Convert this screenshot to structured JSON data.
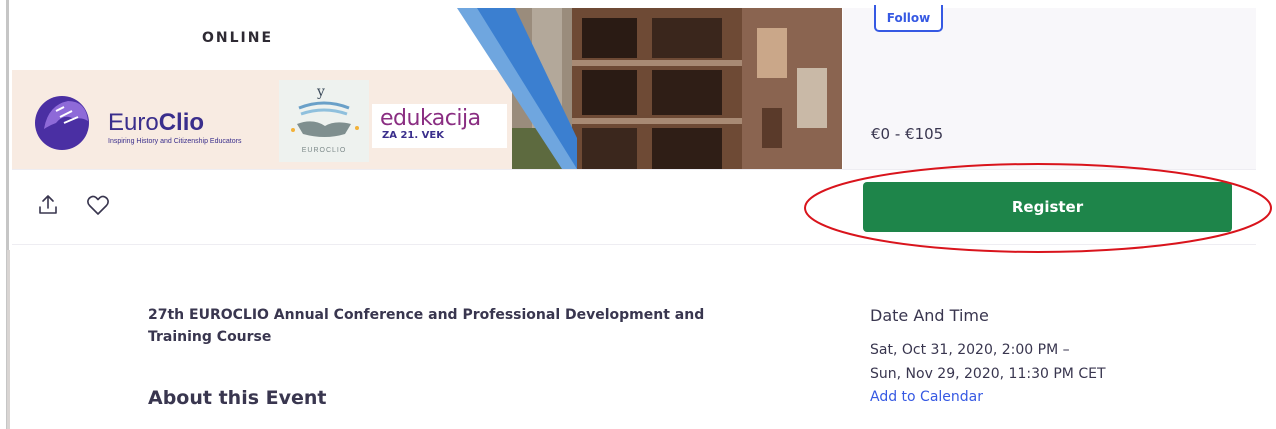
{
  "banner": {
    "online_label": "ONLINE",
    "euroclio": {
      "word_light": "Euro",
      "word_bold": "Clio",
      "tagline": "Inspiring History and Citizenship Educators"
    },
    "badge_label": "EUROCLIO",
    "edukacija": {
      "word": "edukacija",
      "sub": "ZA 21. VEK"
    }
  },
  "organizer": {
    "follow_label": "Follow"
  },
  "price": "€0 - €105",
  "actions": {
    "share_icon": "share-icon",
    "like_icon": "heart-icon",
    "register_label": "Register"
  },
  "event": {
    "title": "27th EUROCLIO Annual Conference and Professional Development and Training Course",
    "about_heading": "About this Event"
  },
  "date_time": {
    "heading": "Date And Time",
    "start": "Sat, Oct 31, 2020, 2:00 PM –",
    "end": "Sun, Nov 29, 2020, 11:30 PM CET",
    "add_to_calendar": "Add to Calendar"
  },
  "colors": {
    "register_green": "#1e854a",
    "link_blue": "#3659e3",
    "annotation_red": "#d9141c"
  }
}
